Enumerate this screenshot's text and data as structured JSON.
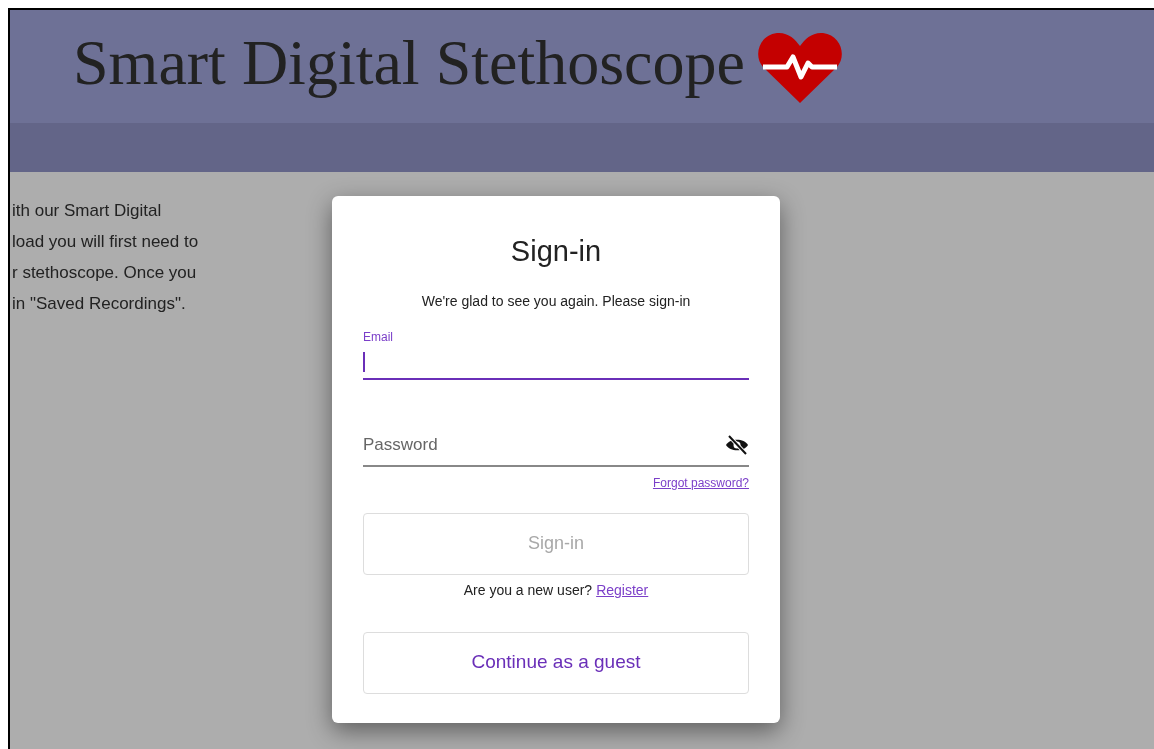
{
  "header": {
    "title": "Smart Digital Stethoscope"
  },
  "background_text": [
    "ith our Smart Digital",
    "load you will first need to",
    "r stethoscope. Once you",
    "in \"Saved Recordings\"."
  ],
  "dialog": {
    "title": "Sign-in",
    "subtitle": "We're glad to see you again. Please sign-in",
    "email": {
      "label": "Email",
      "focused": true
    },
    "password": {
      "placeholder": "Password",
      "visible": false
    },
    "forgot_link": "Forgot password?",
    "sign_in_button": {
      "label": "Sign-in",
      "disabled": true
    },
    "register_prompt": "Are you a new user?",
    "register_link": "Register",
    "guest_button": "Continue as a guest"
  }
}
